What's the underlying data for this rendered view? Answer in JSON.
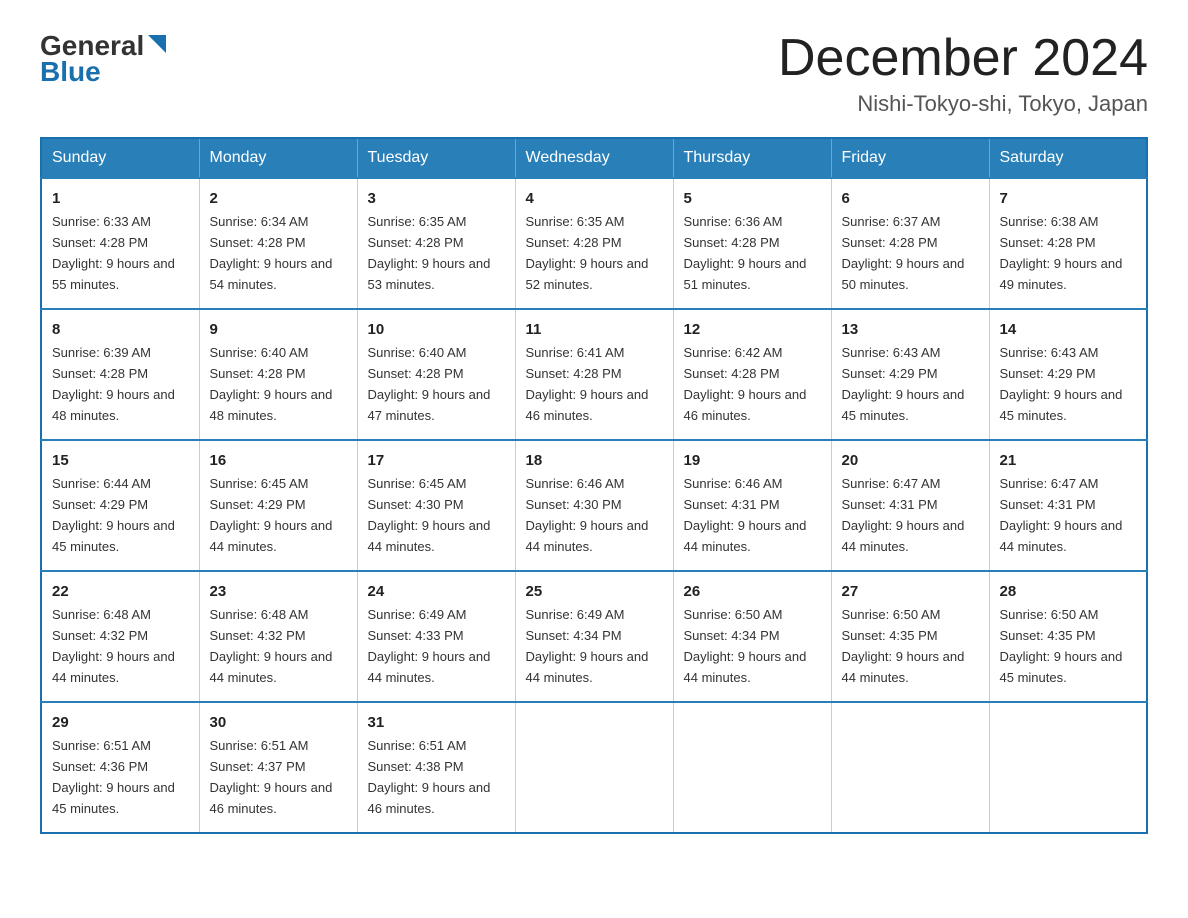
{
  "logo": {
    "part1": "General",
    "part2": "Blue"
  },
  "header": {
    "month_title": "December 2024",
    "subtitle": "Nishi-Tokyo-shi, Tokyo, Japan"
  },
  "days_of_week": [
    "Sunday",
    "Monday",
    "Tuesday",
    "Wednesday",
    "Thursday",
    "Friday",
    "Saturday"
  ],
  "weeks": [
    [
      {
        "day": "1",
        "sunrise": "6:33 AM",
        "sunset": "4:28 PM",
        "daylight": "9 hours and 55 minutes."
      },
      {
        "day": "2",
        "sunrise": "6:34 AM",
        "sunset": "4:28 PM",
        "daylight": "9 hours and 54 minutes."
      },
      {
        "day": "3",
        "sunrise": "6:35 AM",
        "sunset": "4:28 PM",
        "daylight": "9 hours and 53 minutes."
      },
      {
        "day": "4",
        "sunrise": "6:35 AM",
        "sunset": "4:28 PM",
        "daylight": "9 hours and 52 minutes."
      },
      {
        "day": "5",
        "sunrise": "6:36 AM",
        "sunset": "4:28 PM",
        "daylight": "9 hours and 51 minutes."
      },
      {
        "day": "6",
        "sunrise": "6:37 AM",
        "sunset": "4:28 PM",
        "daylight": "9 hours and 50 minutes."
      },
      {
        "day": "7",
        "sunrise": "6:38 AM",
        "sunset": "4:28 PM",
        "daylight": "9 hours and 49 minutes."
      }
    ],
    [
      {
        "day": "8",
        "sunrise": "6:39 AM",
        "sunset": "4:28 PM",
        "daylight": "9 hours and 48 minutes."
      },
      {
        "day": "9",
        "sunrise": "6:40 AM",
        "sunset": "4:28 PM",
        "daylight": "9 hours and 48 minutes."
      },
      {
        "day": "10",
        "sunrise": "6:40 AM",
        "sunset": "4:28 PM",
        "daylight": "9 hours and 47 minutes."
      },
      {
        "day": "11",
        "sunrise": "6:41 AM",
        "sunset": "4:28 PM",
        "daylight": "9 hours and 46 minutes."
      },
      {
        "day": "12",
        "sunrise": "6:42 AM",
        "sunset": "4:28 PM",
        "daylight": "9 hours and 46 minutes."
      },
      {
        "day": "13",
        "sunrise": "6:43 AM",
        "sunset": "4:29 PM",
        "daylight": "9 hours and 45 minutes."
      },
      {
        "day": "14",
        "sunrise": "6:43 AM",
        "sunset": "4:29 PM",
        "daylight": "9 hours and 45 minutes."
      }
    ],
    [
      {
        "day": "15",
        "sunrise": "6:44 AM",
        "sunset": "4:29 PM",
        "daylight": "9 hours and 45 minutes."
      },
      {
        "day": "16",
        "sunrise": "6:45 AM",
        "sunset": "4:29 PM",
        "daylight": "9 hours and 44 minutes."
      },
      {
        "day": "17",
        "sunrise": "6:45 AM",
        "sunset": "4:30 PM",
        "daylight": "9 hours and 44 minutes."
      },
      {
        "day": "18",
        "sunrise": "6:46 AM",
        "sunset": "4:30 PM",
        "daylight": "9 hours and 44 minutes."
      },
      {
        "day": "19",
        "sunrise": "6:46 AM",
        "sunset": "4:31 PM",
        "daylight": "9 hours and 44 minutes."
      },
      {
        "day": "20",
        "sunrise": "6:47 AM",
        "sunset": "4:31 PM",
        "daylight": "9 hours and 44 minutes."
      },
      {
        "day": "21",
        "sunrise": "6:47 AM",
        "sunset": "4:31 PM",
        "daylight": "9 hours and 44 minutes."
      }
    ],
    [
      {
        "day": "22",
        "sunrise": "6:48 AM",
        "sunset": "4:32 PM",
        "daylight": "9 hours and 44 minutes."
      },
      {
        "day": "23",
        "sunrise": "6:48 AM",
        "sunset": "4:32 PM",
        "daylight": "9 hours and 44 minutes."
      },
      {
        "day": "24",
        "sunrise": "6:49 AM",
        "sunset": "4:33 PM",
        "daylight": "9 hours and 44 minutes."
      },
      {
        "day": "25",
        "sunrise": "6:49 AM",
        "sunset": "4:34 PM",
        "daylight": "9 hours and 44 minutes."
      },
      {
        "day": "26",
        "sunrise": "6:50 AM",
        "sunset": "4:34 PM",
        "daylight": "9 hours and 44 minutes."
      },
      {
        "day": "27",
        "sunrise": "6:50 AM",
        "sunset": "4:35 PM",
        "daylight": "9 hours and 44 minutes."
      },
      {
        "day": "28",
        "sunrise": "6:50 AM",
        "sunset": "4:35 PM",
        "daylight": "9 hours and 45 minutes."
      }
    ],
    [
      {
        "day": "29",
        "sunrise": "6:51 AM",
        "sunset": "4:36 PM",
        "daylight": "9 hours and 45 minutes."
      },
      {
        "day": "30",
        "sunrise": "6:51 AM",
        "sunset": "4:37 PM",
        "daylight": "9 hours and 46 minutes."
      },
      {
        "day": "31",
        "sunrise": "6:51 AM",
        "sunset": "4:38 PM",
        "daylight": "9 hours and 46 minutes."
      },
      null,
      null,
      null,
      null
    ]
  ]
}
